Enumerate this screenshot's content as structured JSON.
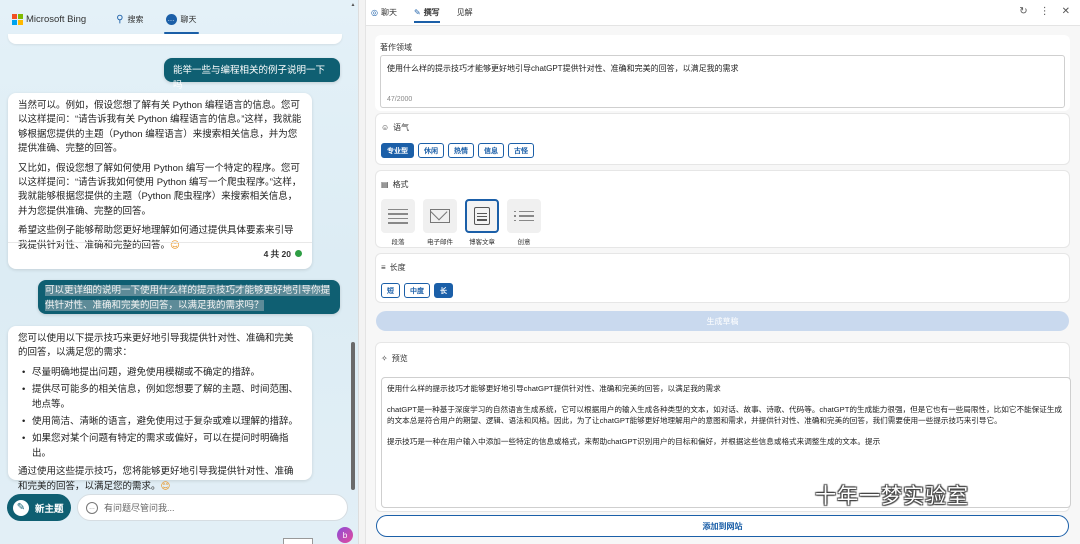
{
  "left": {
    "brand": "Microsoft Bing",
    "tabs": [
      {
        "label": "搜索",
        "icon": "search-icon"
      },
      {
        "label": "聊天",
        "icon": "chat-icon"
      }
    ],
    "user_message_1": "能举一些与编程相关的例子说明一下吗",
    "bot_card_1": {
      "p1": "当然可以。例如，假设您想了解有关 Python 编程语言的信息。您可以这样提问：“请告诉我有关 Python 编程语言的信息。”这样，我就能够根据您提供的主题（Python 编程语言）来搜索相关信息，并为您提供准确、完整的回答。",
      "p2": "又比如，假设您想了解如何使用 Python 编写一个特定的程序。您可以这样提问：“请告诉我如何使用 Python 编写一个爬虫程序。”这样，我就能够根据您提供的主题（Python 爬虫程序）来搜索相关信息，并为您提供准确、完整的回答。",
      "p3": "希望这些例子能够帮助您更好地理解如何通过提供具体要素来引导我提供针对性、准确和完整的回答。",
      "emoji": "😊",
      "counter": "4 共 20"
    },
    "user_message_2": "可以更详细的说明一下使用什么样的提示技巧才能够更好地引导你提供针对性、准确和完美的回答，以满足我的需求吗？",
    "bot_card_2": {
      "intro": "您可以使用以下提示技巧来更好地引导我提供针对性、准确和完美的回答，以满足您的需求：",
      "bullets": [
        "尽量明确地提出问题，避免使用模糊或不确定的措辞。",
        "提供尽可能多的相关信息，例如您想要了解的主题、时间范围、地点等。",
        "使用简洁、清晰的语言，避免使用过于复杂或难以理解的措辞。",
        "如果您对某个问题有特定的需求或偏好，可以在提问时明确指出。"
      ],
      "outro": "通过使用这些提示技巧，您将能够更好地引导我提供针对性、准确和完美的回答，以满足您的需求。",
      "emoji": "😊"
    },
    "new_topic_label": "新主题",
    "input_placeholder": "有问题尽管问我..."
  },
  "right": {
    "tabs": [
      {
        "label": "聊天",
        "icon": "chat-icon"
      },
      {
        "label": "撰写",
        "icon": "compose-icon"
      },
      {
        "label": "见解",
        "icon": ""
      }
    ],
    "topic": {
      "title": "著作领域",
      "value": "使用什么样的提示技巧才能够更好地引导chatGPT提供针对性、准确和完美的回答，以满足我的需求",
      "count": "47/2000"
    },
    "tone": {
      "title": "语气",
      "options": [
        "专业型",
        "休闲",
        "热情",
        "信息",
        "古怪"
      ],
      "selected": 0
    },
    "format": {
      "title": "格式",
      "options": [
        "段落",
        "电子邮件",
        "博客文章",
        "创意"
      ],
      "selected": 2
    },
    "length": {
      "title": "长度",
      "options": [
        "短",
        "中度",
        "长"
      ],
      "selected": 2
    },
    "generate_label": "生成草稿",
    "preview": {
      "title": "预览",
      "p1": "使用什么样的提示技巧才能够更好地引导chatGPT提供针对性、准确和完美的回答，以满足我的需求",
      "p2": "chatGPT是一种基于深度学习的自然语言生成系统，它可以根据用户的输入生成各种类型的文本，如对话、故事、诗歌、代码等。chatGPT的生成能力很强，但是它也有一些局限性，比如它不能保证生成的文本总是符合用户的期望、逻辑、语法和风格。因此，为了让chatGPT能够更好地理解用户的意图和需求，并提供针对性、准确和完美的回答，我们需要使用一些提示技巧来引导它。",
      "p3": "提示技巧是一种在用户输入中添加一些特定的信息或格式，来帮助chatGPT识别用户的目标和偏好，并根据这些信息或格式来调整生成的文本。提示"
    },
    "add_label": "添加到网站"
  },
  "watermark": "十年一梦实验室",
  "colors": {
    "brand_teal": "#0f5f72",
    "accent_blue": "#1b5fa8",
    "generate_disabled": "#c9d9ee"
  }
}
